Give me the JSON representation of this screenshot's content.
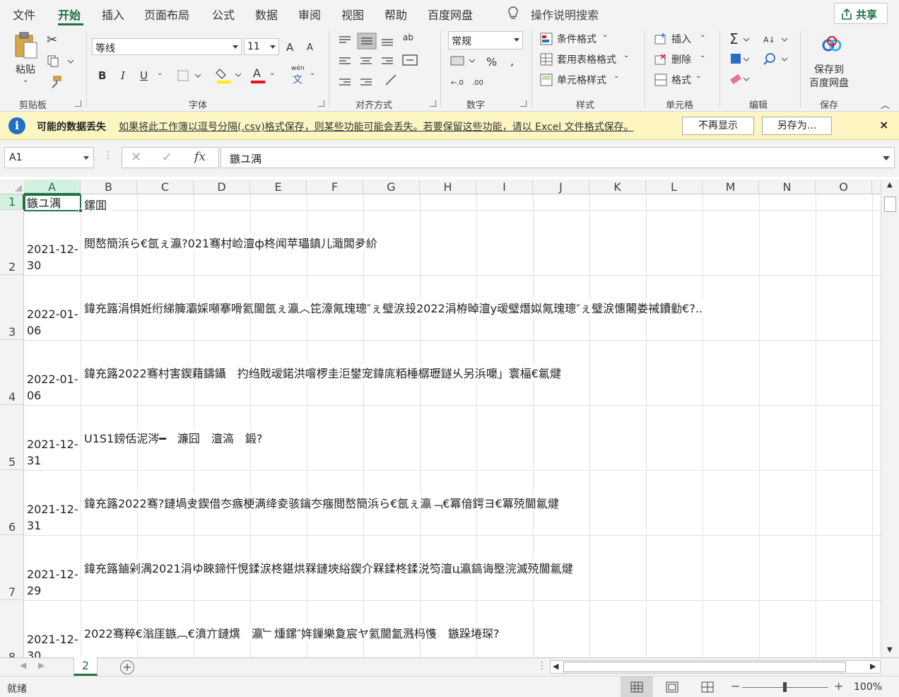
{
  "menu": {
    "tabs": [
      "文件",
      "开始",
      "插入",
      "页面布局",
      "公式",
      "数据",
      "审阅",
      "视图",
      "帮助",
      "百度网盘"
    ],
    "active_tab": "开始",
    "search": "操作说明搜索",
    "share": "共享"
  },
  "ribbon": {
    "clipboard": {
      "label": "剪贴板",
      "paste": "粘贴"
    },
    "font": {
      "label": "字体",
      "font_name": "等线",
      "font_size": "11",
      "bold": "B",
      "italic": "I",
      "underline": "U",
      "grow": "A",
      "shrink": "A",
      "wen": "wén",
      "wen_char": "文"
    },
    "alignment": {
      "label": "对齐方式"
    },
    "number": {
      "label": "数字",
      "format": "常规"
    },
    "styles": {
      "label": "样式",
      "conditional": "条件格式",
      "table": "套用表格格式",
      "cell_styles": "单元格样式"
    },
    "cells": {
      "label": "单元格",
      "insert": "插入",
      "delete": "删除",
      "format": "格式"
    },
    "editing": {
      "label": "编辑"
    },
    "save": {
      "label": "保存",
      "btn_line1": "保存到",
      "btn_line2": "百度网盘"
    }
  },
  "warning": {
    "title": "可能的数据丢失",
    "message": "如果将此工作簿以逗号分隔(.csv)格式保存，则某些功能可能会丢失。若要保留这些功能，请以 Excel 文件格式保存。",
    "btn_dismiss": "不再显示",
    "btn_saveas": "另存为...",
    "close": "×"
  },
  "formula_bar": {
    "name_box": "A1",
    "formula": "鏃ユ湡"
  },
  "columns": [
    "A",
    "B",
    "C",
    "D",
    "E",
    "F",
    "G",
    "H",
    "I",
    "J",
    "K",
    "L",
    "M",
    "N",
    "O"
  ],
  "selected_column": "A",
  "rows": [
    {
      "num": "1",
      "a": "鏃ユ湡",
      "b": "鏍囬"
    },
    {
      "num": "2",
      "a": "2021-12-30",
      "b": "閲嶅簡浜ら€氬ぇ瀛?021骞村崄澶ф柊闻苹瓃鎮儿濈闆夛紒"
    },
    {
      "num": "3",
      "a": "2022-01-06",
      "b": "鍏充簬涓惧姙绗綈簲灞婇噸搴嗗氦閫氬ぇ瀛︿笓濠氞瑰璁″ぇ璧涙殶2022涓栫晫澶у叆璧熸姒氞瑰璁″ぇ璧涙憓闂娄祴鐨勭€?.."
    },
    {
      "num": "4",
      "a": "2022-01-06",
      "b": "鍏充簬2022骞村害鍥藉鑄鑷　扚绉戝叆鍩洪噾椤圭洰鐢宠鍏庣粨棰樼瓑鐩乆另浜嚰」寰楅€氱煡"
    },
    {
      "num": "5",
      "a": "2021-12-31",
      "b": "U1S1鎊佸泥涔━　濂囧　澶滈　鍛?"
    },
    {
      "num": "6",
      "a": "2021-12-31",
      "b": "鍏充簬2022骞?鏈堝叏鍥借冭瘯梗满绛夌骇鑰冭瘬閲嶅簡浜ら€氬ぇ瀛﹁€冪偣鍔ヨ€冪殑閫氱煡"
    },
    {
      "num": "7",
      "a": "2021-12-29",
      "b": "鍏充簬鏀剁湡2021涓ゆ睞鍗忓悓鍒涙柊鍖烘槑鏈埉綌鍥介槑鍒柊鍒涚笉澶ц瀛鎬诲壂浣滅殑閫氱煡"
    },
    {
      "num": "8",
      "a": "2021-12-30",
      "b": "2022骞粹€滃厓鏃︹€濆亣鏈熼　瀛﹂煄鏍″姩鏁樂夐宸ヤ氦閫氳溅杩愯　鏃跺埢琛?"
    }
  ],
  "sheet_tab": "2",
  "status": {
    "text": "就绪",
    "zoom": "100%"
  }
}
